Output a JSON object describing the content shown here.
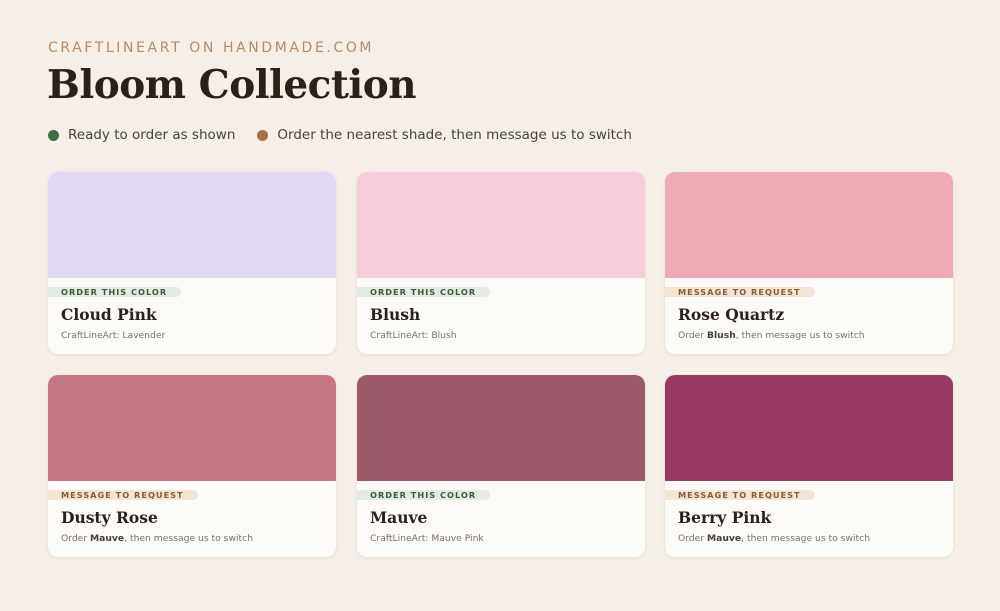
{
  "header": {
    "eyebrow": "CRAFTLINEART ON HANDMADE.COM",
    "title": "Bloom Collection"
  },
  "legend": [
    {
      "label": "Ready to order as shown",
      "color": "#3f6e45"
    },
    {
      "label": "Order the nearest shade, then message us to switch",
      "color": "#a57245"
    }
  ],
  "colors": {
    "background": "#f5efe7",
    "ready_badge_bg": "#e3ece2",
    "ready_badge_text": "#3a5a3c",
    "message_badge_bg": "#f3e5d5",
    "message_badge_text": "#8a5a32"
  },
  "cards": [
    {
      "swatch": "#e3d7f6",
      "status": "order",
      "badge": "ORDER THIS COLOR",
      "name": "Cloud Pink",
      "sub_prefix": "CraftLineArt: Lavender",
      "sub_bold": "",
      "sub_suffix": ""
    },
    {
      "swatch": "#f6cdd8",
      "status": "order",
      "badge": "ORDER THIS COLOR",
      "name": "Blush",
      "sub_prefix": "CraftLineArt: Blush",
      "sub_bold": "",
      "sub_suffix": ""
    },
    {
      "swatch": "#efabb5",
      "status": "message",
      "badge": "MESSAGE TO REQUEST",
      "name": "Rose Quartz",
      "sub_prefix": "Order ",
      "sub_bold": "Blush",
      "sub_suffix": ", then message us to switch"
    },
    {
      "swatch": "#c77782",
      "status": "message",
      "badge": "MESSAGE TO REQUEST",
      "name": "Dusty Rose",
      "sub_prefix": "Order ",
      "sub_bold": "Mauve",
      "sub_suffix": ", then message us to switch"
    },
    {
      "swatch": "#9a5a6a",
      "status": "order",
      "badge": "ORDER THIS COLOR",
      "name": "Mauve",
      "sub_prefix": "CraftLineArt: Mauve Pink",
      "sub_bold": "",
      "sub_suffix": ""
    },
    {
      "swatch": "#983a62",
      "status": "message",
      "badge": "MESSAGE TO REQUEST",
      "name": "Berry Pink",
      "sub_prefix": "Order ",
      "sub_bold": "Mauve",
      "sub_suffix": ", then message us to switch"
    }
  ]
}
